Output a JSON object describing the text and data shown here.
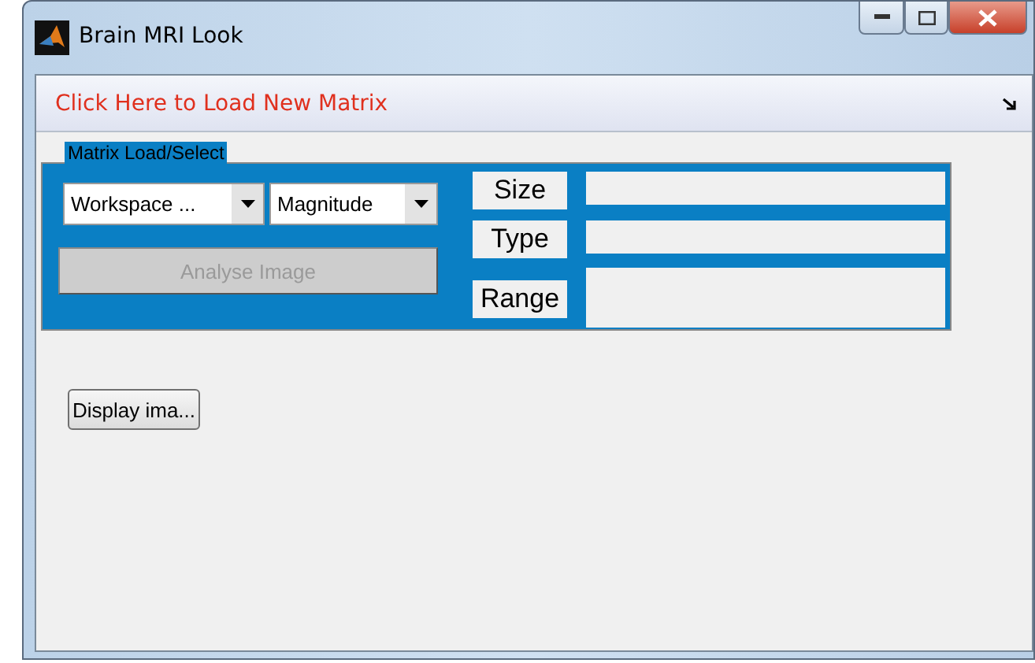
{
  "window": {
    "title": "Brain MRI Look"
  },
  "menu_bar": {
    "label": "Click Here to Load New Matrix"
  },
  "panel": {
    "title": "Matrix Load/Select",
    "dropdowns": [
      {
        "value": "Workspace ..."
      },
      {
        "value": "Magnitude"
      }
    ],
    "analyse_button": {
      "label": "Analyse Image",
      "disabled": true
    },
    "properties": [
      {
        "label": "Size"
      },
      {
        "label": "Type"
      },
      {
        "label": "Range"
      }
    ]
  },
  "display_button": {
    "label": "Display ima..."
  }
}
